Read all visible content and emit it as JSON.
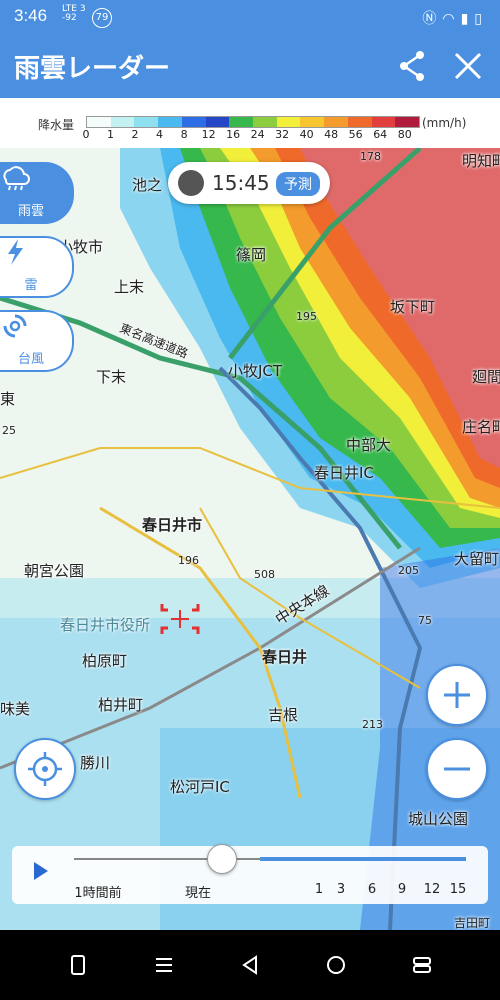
{
  "status_bar": {
    "time": "3:46",
    "network_line1": "LTE 3",
    "network_line2": "-92",
    "badge": "79"
  },
  "header": {
    "title": "雨雲レーダー"
  },
  "legend": {
    "label": "降水量",
    "unit": "(mm/h)",
    "ticks": [
      "0",
      "1",
      "2",
      "4",
      "8",
      "12",
      "16",
      "24",
      "32",
      "40",
      "48",
      "56",
      "64",
      "80"
    ],
    "colors": [
      "#f4fbfb",
      "#c3f0f1",
      "#8fe0ee",
      "#49b9ef",
      "#2d6de6",
      "#2646c8",
      "#37b84c",
      "#8ccd3e",
      "#f1ef3a",
      "#f6c52f",
      "#f39b2c",
      "#ef6a2a",
      "#e33d3d",
      "#b21c3c"
    ]
  },
  "time_badge": {
    "time": "15:45",
    "label": "予測"
  },
  "side_buttons": [
    {
      "label": "雨雲",
      "icon": "cloud-rain-icon"
    },
    {
      "label": "雷",
      "icon": "lightning-icon"
    },
    {
      "label": "台風",
      "icon": "typhoon-icon"
    }
  ],
  "map_labels": {
    "ikeno": "池之",
    "komaki": "小牧市",
    "shinooka": "篠岡",
    "kamisue": "上末",
    "shimosue": "下末",
    "sakashita": "坂下町",
    "komaki_jct": "小牧JCT",
    "tomei": "東名高速道路",
    "chubu_univ": "中部大",
    "kasugai_ic": "春日井IC",
    "kasugai_city": "春日井市",
    "asamiya": "朝宮公園",
    "city_hall": "春日井市役所",
    "kasugai_station": "春日井",
    "chuo_line": "中央本線",
    "kashiwara": "柏原町",
    "kashiwai": "柏井町",
    "yoshine": "吉根",
    "katsukawa": "勝川",
    "matsukawado": "松河戸IC",
    "shiroyama": "城山公園",
    "meichi": "明知町",
    "sakaecho": "庄名町",
    "ootomecho": "大留町",
    "mawari": "廻間",
    "higashi": "東",
    "mi": "味美",
    "yoshida": "吉田町",
    "road_178": "178",
    "road_195": "195",
    "road_196": "196",
    "road_508": "508",
    "road_205": "205",
    "road_75": "75",
    "road_213": "213",
    "road_25": "25"
  },
  "timeline": {
    "labels": [
      "1時間前",
      "現在",
      "1",
      "3",
      "6",
      "9",
      "12",
      "15"
    ],
    "position_fraction": 0.375
  }
}
